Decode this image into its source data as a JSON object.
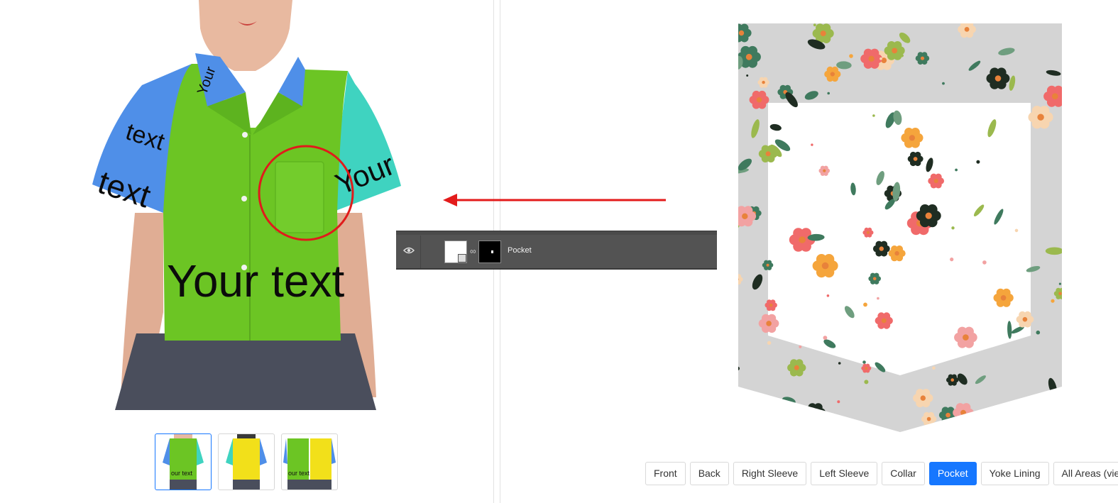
{
  "preview": {
    "shirt_text_front": "Your text",
    "sleeve_text": "text",
    "collar_text": "Your",
    "colors": {
      "body": "#6cc524",
      "left_sleeve": "#4f8fe8",
      "right_sleeve": "#3fd3c0",
      "collar": "#4f8fe8",
      "highlight_circle": "#e01b1b"
    }
  },
  "thumbnails": [
    {
      "view": "front",
      "label": "our text",
      "active": true
    },
    {
      "view": "back",
      "label": "",
      "active": false
    },
    {
      "view": "front-back",
      "label": "our text",
      "active": false
    }
  ],
  "layer_panel": {
    "layer_name": "Pocket",
    "visible_icon": "eye-icon",
    "link_icon": "chain-link-icon"
  },
  "arrow": {
    "color": "#e31b1b",
    "icon": "arrow-left-icon"
  },
  "pattern": {
    "name": "floral-pattern",
    "frame_color": "#d4d4d4",
    "flower_colors": [
      "#f06a6a",
      "#f5a53c",
      "#f7d5b0",
      "#3f7a5e",
      "#9bb94e",
      "#1f2d22",
      "#f2a2a2"
    ]
  },
  "tabs": [
    {
      "label": "Front",
      "active": false
    },
    {
      "label": "Back",
      "active": false
    },
    {
      "label": "Right Sleeve",
      "active": false
    },
    {
      "label": "Left Sleeve",
      "active": false
    },
    {
      "label": "Collar",
      "active": false
    },
    {
      "label": "Pocket",
      "active": true
    },
    {
      "label": "Yoke Lining",
      "active": false
    },
    {
      "label": "All Areas (vie",
      "active": false
    }
  ]
}
